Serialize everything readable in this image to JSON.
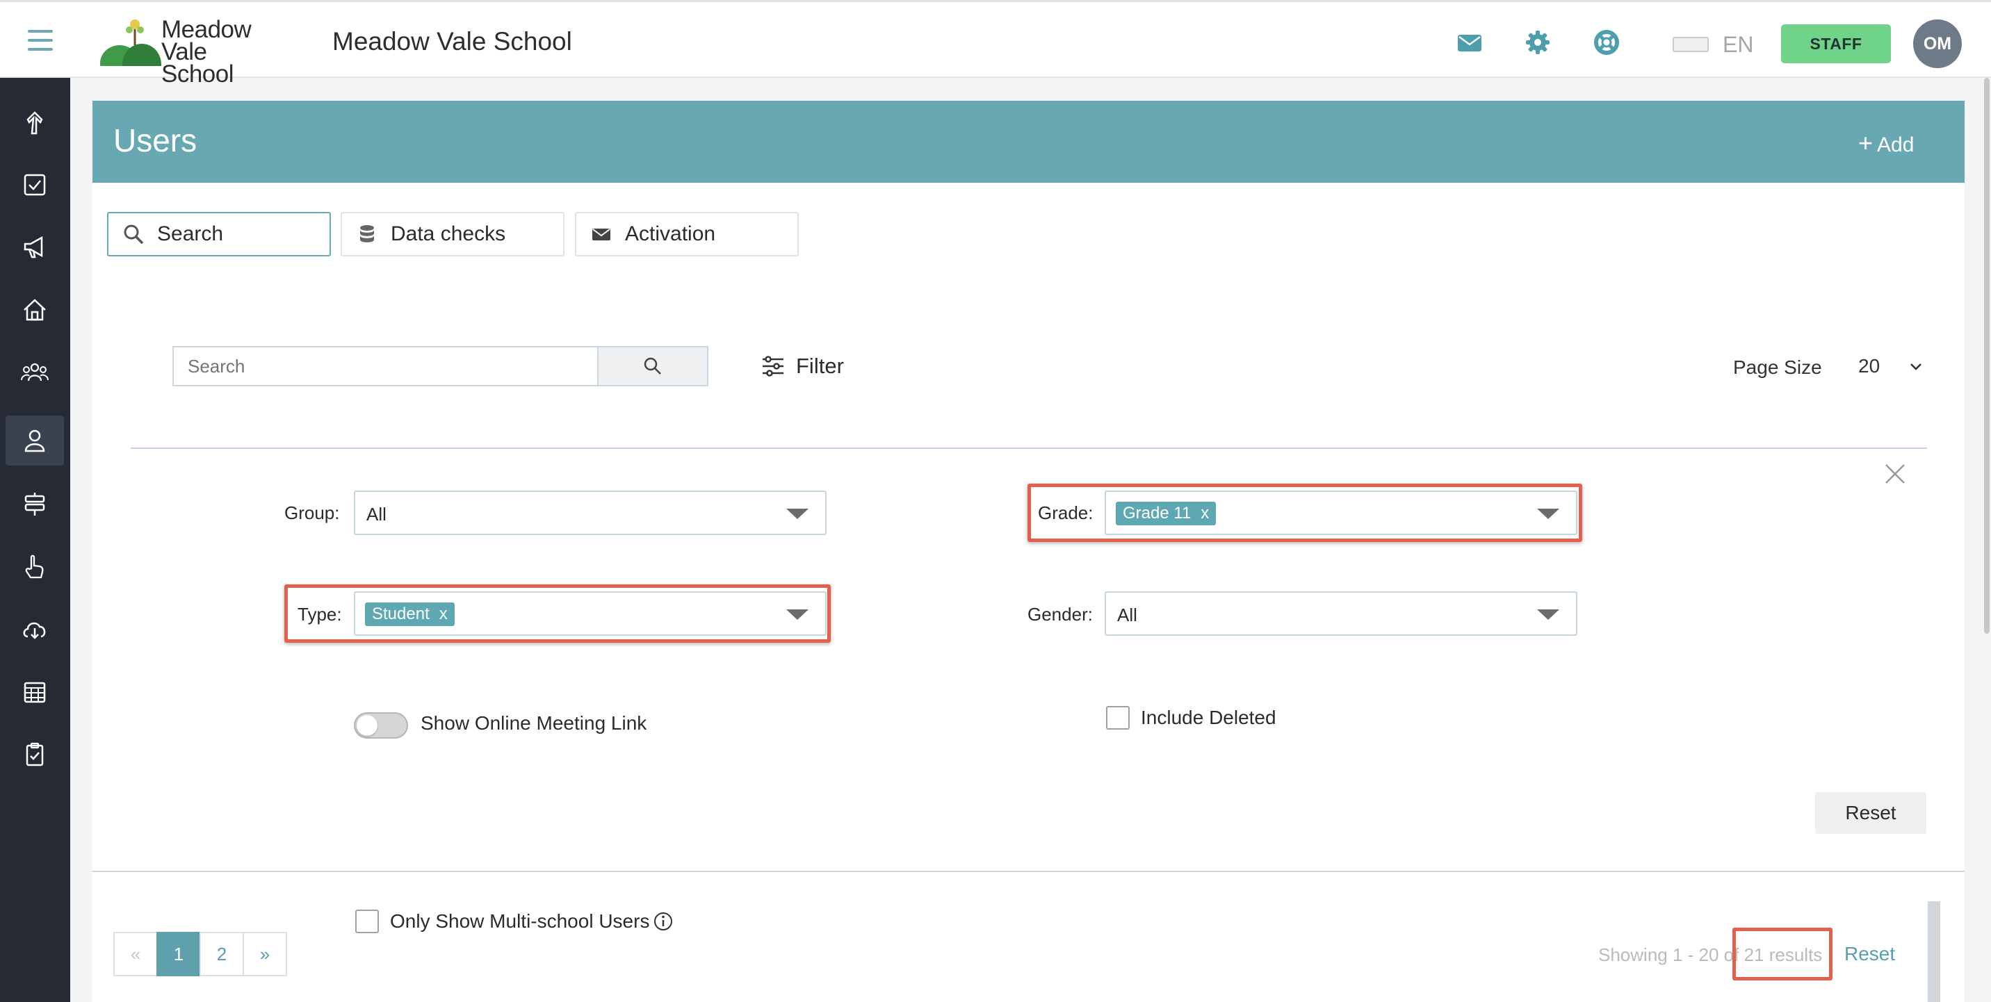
{
  "header": {
    "logo_line1": "Meadow",
    "logo_line2": "Vale School",
    "school_name": "Meadow Vale School",
    "icons": [
      "mail-icon",
      "gear-icon",
      "lifebuoy-icon"
    ],
    "language": "EN",
    "staff_label": "STAFF",
    "avatar_initials": "OM"
  },
  "sidebar": {
    "items": [
      "arrow-up-icon",
      "checkbox-icon",
      "megaphone-icon",
      "home-icon",
      "group-icon",
      "user-icon",
      "signpost-icon",
      "hand-pointer-icon",
      "cloud-download-icon",
      "calendar-grid-icon",
      "clipboard-check-icon"
    ],
    "active_index": 5
  },
  "page": {
    "title": "Users",
    "add_label": "Add"
  },
  "tabs": [
    {
      "label": "Search",
      "icon": "search-icon",
      "active": true
    },
    {
      "label": "Data checks",
      "icon": "database-icon",
      "active": false
    },
    {
      "label": "Activation",
      "icon": "envelope-icon",
      "active": false
    }
  ],
  "search": {
    "placeholder": "Search",
    "filter_label": "Filter",
    "page_size_label": "Page Size",
    "page_size_value": "20"
  },
  "filters": {
    "group": {
      "label": "Group:",
      "value": "All"
    },
    "grade": {
      "label": "Grade:",
      "chip": "Grade 11",
      "chip_remove": "x"
    },
    "type": {
      "label": "Type:",
      "chip": "Student",
      "chip_remove": "x"
    },
    "gender": {
      "label": "Gender:",
      "value": "All"
    },
    "show_online_meeting_link": {
      "label": "Show Online Meeting Link",
      "enabled": false
    },
    "include_deleted": {
      "label": "Include Deleted",
      "checked": false
    },
    "only_multi_school": {
      "label": "Only Show Multi-school Users",
      "checked": false
    },
    "reset_label": "Reset"
  },
  "pagination": {
    "prev": "«",
    "pages": [
      "1",
      "2"
    ],
    "current": "1",
    "next": "»",
    "showing_text": "Showing 1 - 20 of 21 results",
    "reset_label": "Reset"
  },
  "colors": {
    "accent": "#68a8b3",
    "sidebar_bg": "#252a35",
    "staff_green": "#6fd38a",
    "highlight_red": "#e3604d"
  }
}
